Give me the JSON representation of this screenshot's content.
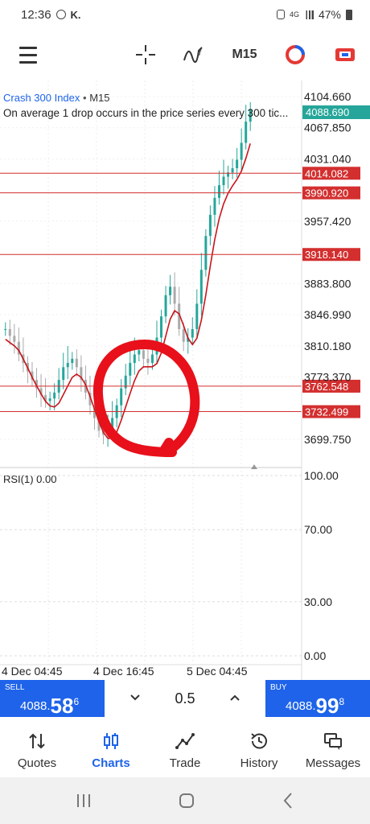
{
  "status_bar": {
    "time": "12:36",
    "battery": "47%",
    "network": "4G"
  },
  "toolbar": {
    "menu_icon": "hamburger-icon",
    "crosshair_icon": "crosshair-icon",
    "indicators_icon": "indicator-icon",
    "timeframe": "M15",
    "objects_icon": "objects-icon",
    "chart_type_icon": "chart-type-icon"
  },
  "chart": {
    "symbol": "Crash 300 Index",
    "symbol_timeframe": "M15",
    "description": "On average 1 drop occurs in the price series every 300 tic...",
    "price_labels": [
      "4104.660",
      "4067.850",
      "4031.040",
      "3957.420",
      "3883.800",
      "3846.990",
      "3810.180",
      "3773.370",
      "3699.750"
    ],
    "current_price": "4088.690",
    "level_lines": [
      "4014.082",
      "3990.920",
      "3918.140",
      "3762.548",
      "3732.499"
    ],
    "rsi_title": "RSI(1) 0.00",
    "rsi_levels": [
      "100.00",
      "70.00",
      "30.00",
      "0.00"
    ],
    "time_labels": [
      "4 Dec 04:45",
      "4 Dec 16:45",
      "5 Dec 04:45"
    ],
    "colors": {
      "bull": "#26a69a",
      "bear": "#aaaaaa",
      "ma": "#c8141a",
      "level": "#d32f2f",
      "current": "#26a69a",
      "annotation": "#e8101a"
    }
  },
  "trade": {
    "sell_label": "SELL",
    "sell_prefix": "4088.",
    "sell_big": "58",
    "sell_sup": "6",
    "buy_label": "BUY",
    "buy_prefix": "4088.",
    "buy_big": "99",
    "buy_sup": "8",
    "volume": "0.5"
  },
  "nav": [
    {
      "label": "Quotes",
      "icon": "quotes-icon"
    },
    {
      "label": "Charts",
      "icon": "charts-icon"
    },
    {
      "label": "Trade",
      "icon": "trade-icon"
    },
    {
      "label": "History",
      "icon": "history-icon"
    },
    {
      "label": "Messages",
      "icon": "messages-icon"
    }
  ]
}
